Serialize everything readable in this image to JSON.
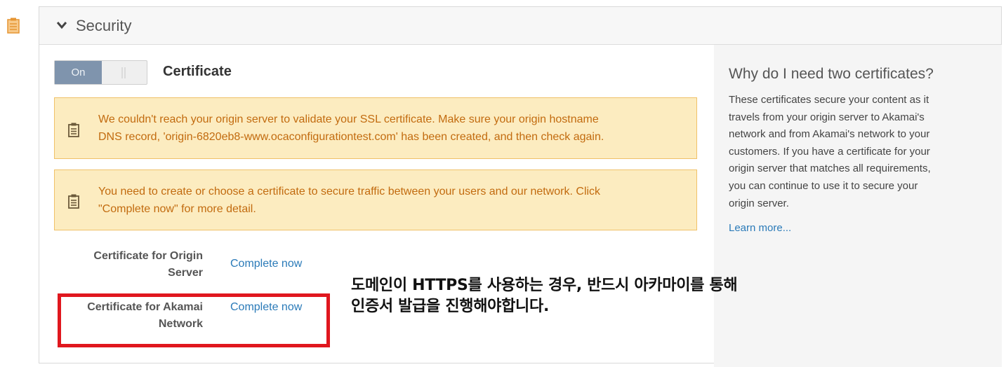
{
  "section": {
    "title": "Security",
    "toggle_label": "On",
    "heading": "Certificate"
  },
  "alerts": [
    {
      "line1": "We couldn't reach your origin server to validate your SSL certificate. Make sure your origin hostname",
      "line2": "DNS record, 'origin-6820eb8-www.ocaconfigurationtest.com' has been created, and then check again."
    },
    {
      "line1": "You need to create or choose a certificate to secure traffic between your users and our network. Click",
      "line2": "\"Complete now\" for more detail."
    }
  ],
  "certificates": [
    {
      "label_line1": "Certificate for Origin",
      "label_line2": "Server",
      "action": "Complete now"
    },
    {
      "label_line1": "Certificate for Akamai",
      "label_line2": "Network",
      "action": "Complete now"
    }
  ],
  "sidebar": {
    "title": "Why do I need two certificates?",
    "lines": [
      "These certificates secure your content as it",
      "travels from your origin server to Akamai's",
      "network and from Akamai's network to your",
      "customers. If you have a certificate for your",
      "origin server that matches all requirements,",
      "you can continue to use it to secure your",
      "origin server."
    ],
    "link": "Learn more..."
  },
  "annotation": {
    "line1": "도메인이 HTTPS를 사용하는 경우, 반드시 아카마이를 통해",
    "line2": "인증서 발급을 진행해야합니다."
  },
  "colors": {
    "warning_bg": "#fcecc0",
    "warning_border": "#f0c168",
    "warning_text": "#c26b0f",
    "link": "#2a7ab8",
    "toggle_on": "#7f94ad",
    "highlight_box": "#e0171e"
  },
  "icons": {
    "left_gutter": "clipboard-icon",
    "collapse": "chevron-down-icon",
    "alert": "clipboard-icon"
  }
}
